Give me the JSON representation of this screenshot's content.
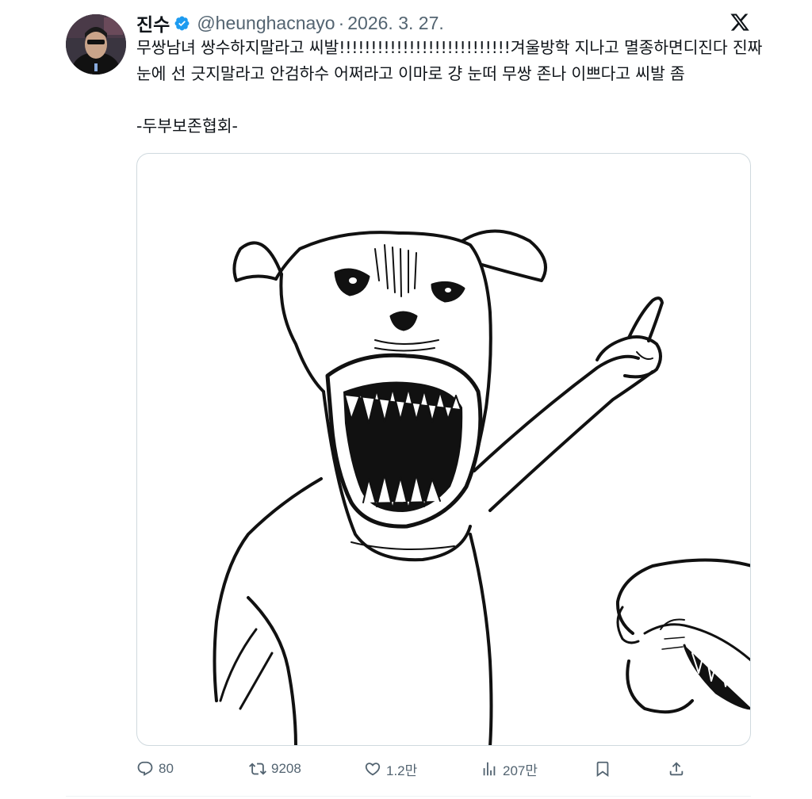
{
  "author": {
    "display_name": "진수",
    "handle": "@heunghacnayo",
    "separator": "·",
    "date": "2026. 3. 27.",
    "verified": true
  },
  "tweet": {
    "text": "무쌍남녀 쌍수하지말라고 씨발!!!!!!!!!!!!!!!!!!!!!!!!!!!겨울방학 지나고 멸종하면디진다 진짜 눈에 선 긋지말라고 안검하수 어쩌라고 이마로 걍 눈떠 무쌍 존나 이쁘다고 씨발 좀",
    "signature": "-두부보존협회-"
  },
  "actions": {
    "reply_count": "80",
    "retweet_count": "9208",
    "like_count": "1.2만",
    "view_count": "207만"
  },
  "icons": {
    "verified": "verified-badge-icon",
    "logo": "x-logo-icon",
    "reply": "reply-icon",
    "retweet": "retweet-icon",
    "like": "heart-icon",
    "views": "views-chart-icon",
    "bookmark": "bookmark-icon",
    "share": "share-icon"
  },
  "colors": {
    "text": "#0f1419",
    "muted": "#536471",
    "verified": "#1d9bf0",
    "border": "#cfd9de"
  }
}
